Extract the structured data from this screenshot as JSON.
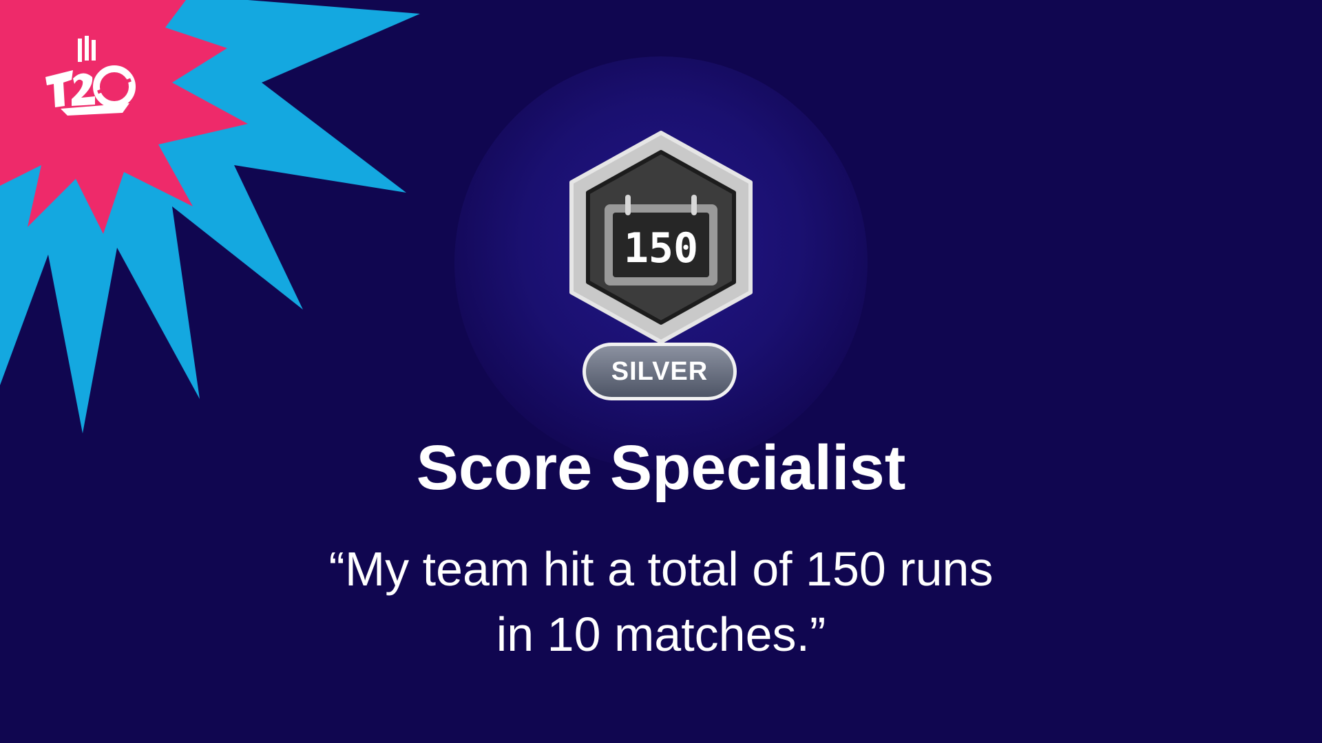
{
  "logo": {
    "text": "T20",
    "icon": "t20-logo-icon"
  },
  "badge": {
    "value": "150",
    "tier": "SILVER",
    "icon": "scoreboard-calendar-icon"
  },
  "achievement": {
    "title": "Score Specialist",
    "quote": "“My team hit a total of 150 runs in 10 matches.”"
  },
  "colors": {
    "background": "#100650",
    "burst_blue": "#14a8e0",
    "burst_pink": "#ee2a6a",
    "badge_silver": "#c8c8c8",
    "badge_dark": "#3a3a3a"
  }
}
